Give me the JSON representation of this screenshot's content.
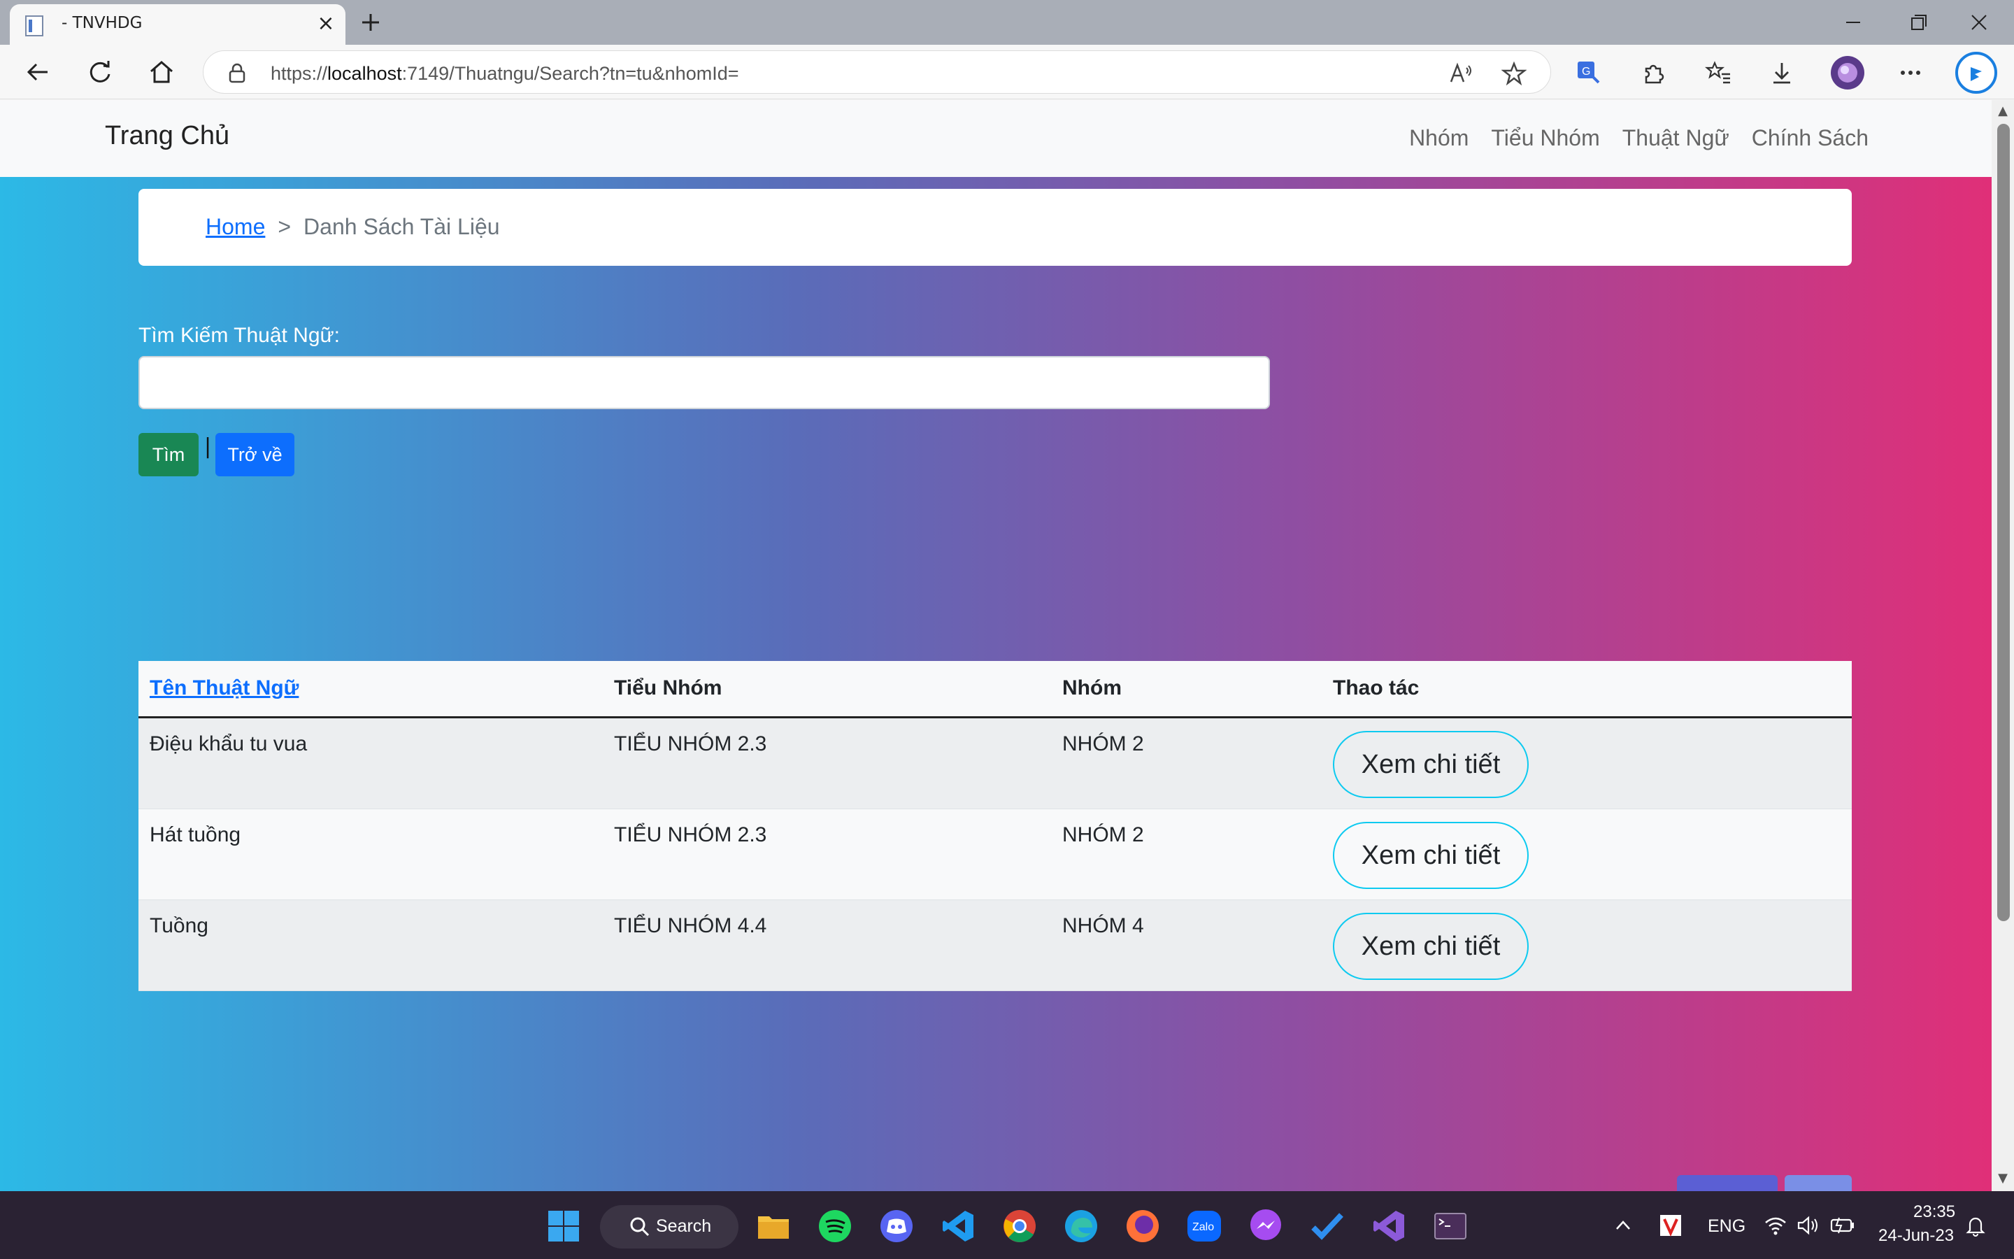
{
  "browser": {
    "tab_title": "- TNVHDG",
    "url_prefix": "https://",
    "url_host": "localhost",
    "url_rest": ":7149/Thuatngu/Search?tn=tu&nhomId="
  },
  "navbar": {
    "brand": "Trang Chủ",
    "links": [
      "Nhóm",
      "Tiểu Nhóm",
      "Thuật Ngữ",
      "Chính Sách"
    ]
  },
  "breadcrumb": {
    "home": "Home",
    "separator": ">",
    "current": "Danh Sách Tài Liệu"
  },
  "search": {
    "label": "Tìm Kiếm Thuật Ngữ:",
    "value": "",
    "search_button": "Tìm",
    "separator": "|",
    "back_button": "Trở về"
  },
  "table": {
    "headers": [
      "Tên Thuật Ngữ",
      "Tiểu Nhóm",
      "Nhóm",
      "Thao tác"
    ],
    "rows": [
      {
        "term": "Điệu khẩu tu vua",
        "subgroup": "TIỂU NHÓM 2.3",
        "group": "NHÓM 2",
        "action": "Xem chi tiết"
      },
      {
        "term": "Hát tuồng",
        "subgroup": "TIỂU NHÓM 2.3",
        "group": "NHÓM 2",
        "action": "Xem chi tiết"
      },
      {
        "term": "Tuồng",
        "subgroup": "TIỂU NHÓM 4.4",
        "group": "NHÓM 4",
        "action": "Xem chi tiết"
      }
    ]
  },
  "taskbar": {
    "search_label": "Search",
    "language": "ENG",
    "time": "23:35",
    "date": "24-Jun-23"
  },
  "colors": {
    "gradient_start": "#2cb9e6",
    "gradient_end": "#e02f78",
    "primary": "#0d6efd",
    "success": "#198754",
    "info_outline": "#0dcaf0"
  }
}
